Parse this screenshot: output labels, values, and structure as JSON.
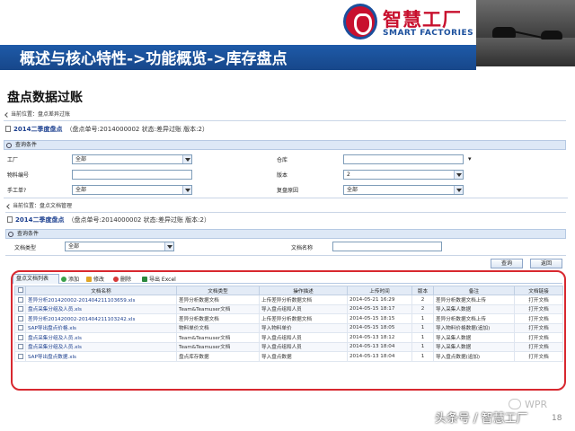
{
  "brand": {
    "cn": "智慧工厂",
    "en": "SMART FACTORIES",
    "reg": "®"
  },
  "slide": {
    "title": "概述与核心特性->功能概览->库存盘点",
    "section_title": "盘点数据过账"
  },
  "panel1": {
    "breadcrumb": "当前位置：盘点差异过账",
    "doc_title": "2014二季度盘点",
    "doc_meta": "（盘点单号:2014000002  状态:差异过账  版本:2）",
    "query_header": "查询条件",
    "fields": {
      "factory_label": "工厂",
      "factory_value": "全部",
      "warehouse_label": "仓库",
      "warehouse_value": "",
      "material_label": "物料编号",
      "material_value": "",
      "version_label": "版本",
      "version_value": "2",
      "manual_label": "手工单?",
      "manual_value": "全部",
      "reinventory_label": "复盘原因",
      "reinventory_value": "全部"
    }
  },
  "panel2": {
    "breadcrumb": "当前位置：盘点文档管理",
    "doc_title": "2014二季度盘点",
    "doc_meta": "（盘点单号:2014000002  状态:差异过账  版本:2）",
    "query_header": "查询条件",
    "doctype_label": "文档类型",
    "doctype_value": "全部",
    "docname_label": "文档名称",
    "docname_value": "",
    "query_button": "查询",
    "back_button": "返回"
  },
  "grid": {
    "tab_label": "盘点文档列表",
    "toolbar": {
      "add": "添加",
      "edit": "修改",
      "delete": "删除",
      "export": "导出 Excel"
    },
    "columns": [
      "文档名称",
      "文档类型",
      "操作描述",
      "上传时间",
      "版本",
      "备注",
      "文档链接"
    ],
    "rows": [
      {
        "name": "差异分析201420002-201404211103659.xls",
        "type": "差异分析数据文档",
        "desc": "上传差异分析数据文档",
        "time": "2014-05-21 16:29",
        "ver": "2",
        "note": "差异分析数据文档上传",
        "link": "打开文档"
      },
      {
        "name": "盘点采集分组及人员.xls",
        "type": "Team&Teamuser文档",
        "desc": "导入盘点组和人员",
        "time": "2014-05-15 18:17",
        "ver": "2",
        "note": "导入采集人数据",
        "link": "打开文档"
      },
      {
        "name": "差异分析201420002-201404211103242.xls",
        "type": "差异分析数据文档",
        "desc": "上传差异分析数据文档",
        "time": "2014-05-15 18:15",
        "ver": "1",
        "note": "差异分析数据文档上传",
        "link": "打开文档"
      },
      {
        "name": "SAP导出盘点价格.xls",
        "type": "物料单价文档",
        "desc": "导入物料单价",
        "time": "2014-05-15 18:05",
        "ver": "1",
        "note": "导入物料价格数据(追加)",
        "link": "打开文档"
      },
      {
        "name": "盘点采集分组及人员.xls",
        "type": "Team&Teamuser文档",
        "desc": "导入盘点组和人员",
        "time": "2014-05-13 18:12",
        "ver": "1",
        "note": "导入采集人数据",
        "link": "打开文档"
      },
      {
        "name": "盘点采集分组及人员.xls",
        "type": "Team&Teamuser文档",
        "desc": "导入盘点组和人员",
        "time": "2014-05-13 18:04",
        "ver": "1",
        "note": "导入采集人数据",
        "link": "打开文档"
      },
      {
        "name": "SAP导出盘点数据.xls",
        "type": "盘点库存数据",
        "desc": "导入盘点数据",
        "time": "2014-05-13 18:04",
        "ver": "1",
        "note": "导入盘点数据(追加)",
        "link": "打开文档"
      }
    ]
  },
  "footer": {
    "source": "头条号 / 智慧工厂",
    "watermark": "WPR",
    "page": "18"
  },
  "colors": {
    "brand_red": "#c8102e",
    "brand_blue": "#1b4f9c",
    "title_bar": "#1e5aa8",
    "highlight_box": "#d8282f"
  }
}
